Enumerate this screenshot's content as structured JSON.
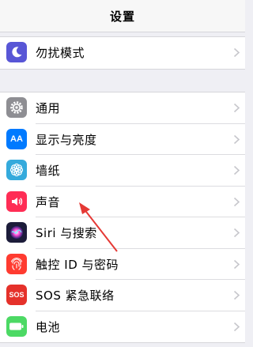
{
  "navbar": {
    "title": "设置"
  },
  "group1": [
    {
      "label": "勿扰模式",
      "icon": "moon-icon",
      "color": "#5856d6"
    }
  ],
  "group2": [
    {
      "label": "通用",
      "icon": "gear-icon",
      "color": "#8e8e93"
    },
    {
      "label": "显示与亮度",
      "icon": "text-size-icon",
      "color": "#007aff",
      "glyph": "AA"
    },
    {
      "label": "墙纸",
      "icon": "flower-icon",
      "color": "#34aadc"
    },
    {
      "label": "声音",
      "icon": "speaker-icon",
      "color": "#ff2d55"
    },
    {
      "label": "Siri 与搜索",
      "icon": "siri-icon",
      "color": "#1c1c3a"
    },
    {
      "label": "触控 ID 与密码",
      "icon": "fingerprint-icon",
      "color": "#ff3b30"
    },
    {
      "label": "SOS 紧急联络",
      "icon": "sos-icon",
      "color": "#e5312a",
      "glyph": "SOS"
    },
    {
      "label": "电池",
      "icon": "battery-icon",
      "color": "#4cd964"
    }
  ],
  "annotation": {
    "color": "#e53935"
  }
}
